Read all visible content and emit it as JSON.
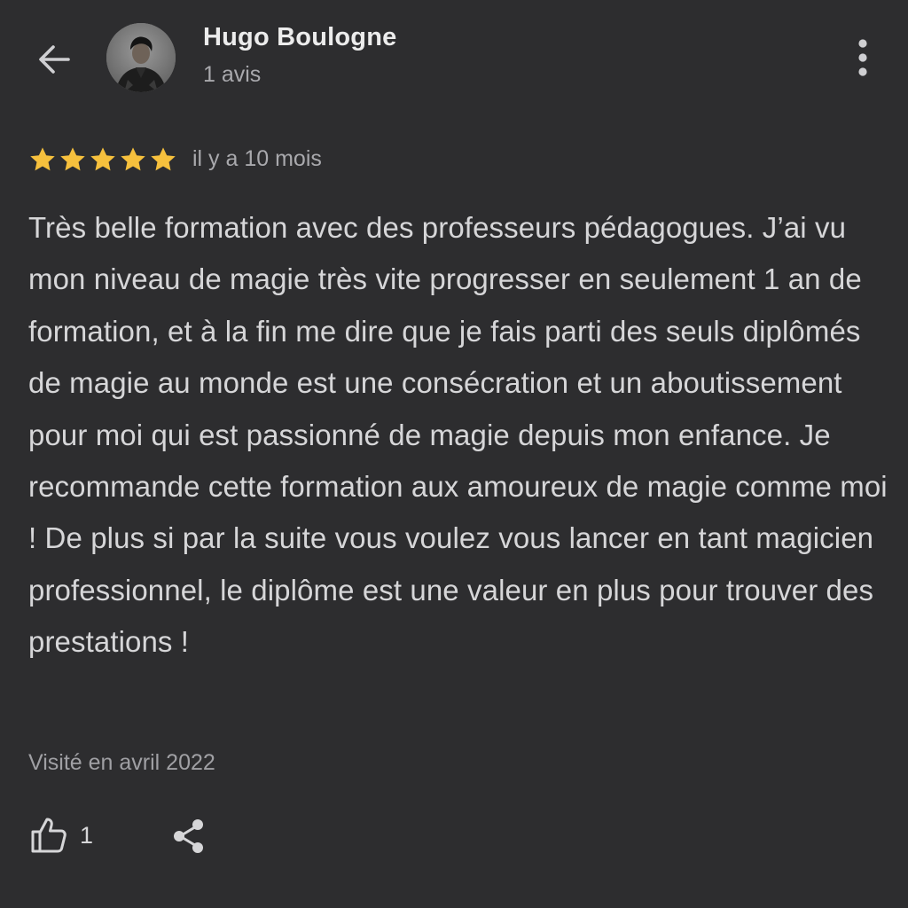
{
  "icons": {
    "back": "arrow-left-icon",
    "more": "more-vertical-icon",
    "star": "star-icon",
    "like": "thumbs-up-icon",
    "share": "share-icon"
  },
  "colors": {
    "background": "#2d2d2f",
    "star": "#f6c03d",
    "text": "#d6d6d8",
    "muted": "#a9a9ad"
  },
  "reviewer": {
    "name": "Hugo Boulogne",
    "review_count": "1 avis"
  },
  "review": {
    "rating": 5,
    "rating_max": 5,
    "time": "il y a 10 mois",
    "text": "Très belle formation avec des professeurs pédagogues. J’ai vu mon niveau de magie très vite progresser en seulement 1 an de formation, et à la fin me dire que je fais parti des seuls diplômés de magie au monde est une consécration et un aboutissement pour moi qui est passionné de magie depuis mon enfance. Je recommande cette formation aux amoureux de magie comme moi ! De plus si par la suite vous voulez vous lancer en tant magicien professionnel, le diplôme est une valeur en plus pour trouver des prestations !",
    "visited": "Visité en avril 2022",
    "likes": "1"
  }
}
